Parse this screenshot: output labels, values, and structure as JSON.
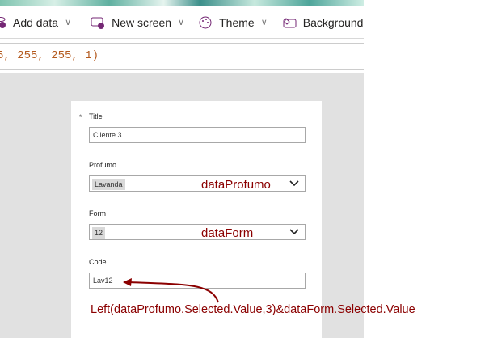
{
  "toolbar": {
    "add_data": "Add data",
    "new_screen": "New screen",
    "theme": "Theme",
    "background": "Background"
  },
  "formula": {
    "text": "5, 255, 255, 1)"
  },
  "form": {
    "required_mark": "*",
    "fields": [
      {
        "label": "Title",
        "value": "Cliente 3"
      },
      {
        "label": "Profumo",
        "value": "Lavanda",
        "annotation": "dataProfumo"
      },
      {
        "label": "Form",
        "value": "12",
        "annotation": "dataForm"
      },
      {
        "label": "Code",
        "value": "Lav12"
      }
    ]
  },
  "annotation": {
    "formula": "Left(dataProfumo.Selected.Value,3)&dataForm.Selected.Value",
    "color": "#8b0000"
  }
}
